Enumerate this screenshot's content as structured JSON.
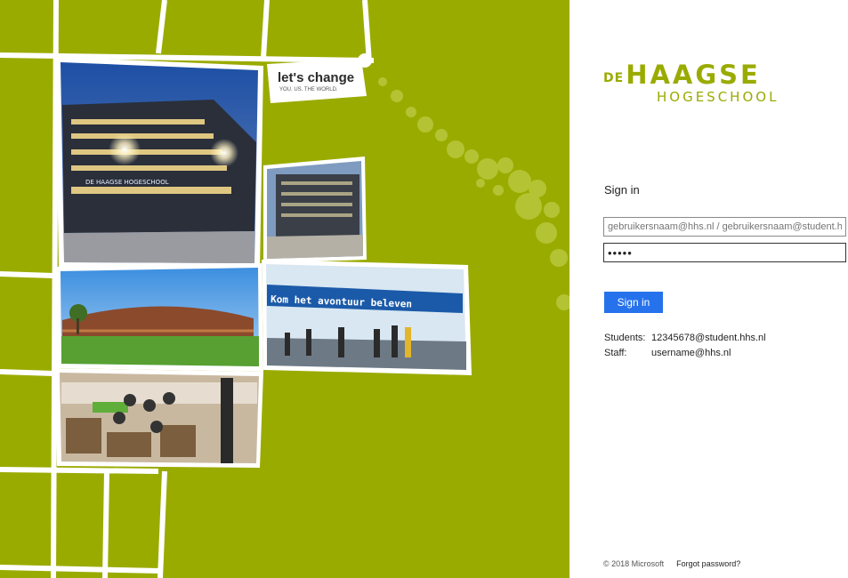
{
  "illustration": {
    "tagline_main": "let's change",
    "tagline_sub": "YOU. US. THE WORLD.",
    "banner_text": "Kom het avontuur beleven",
    "building_sign": "DE HAAGSE HOGESCHOOL"
  },
  "logo": {
    "prefix": "DE",
    "main": "HAAGSE",
    "sub": "HOGESCHOOL"
  },
  "signin": {
    "heading": "Sign in",
    "username_placeholder": "gebruikersnaam@hhs.nl / gebruikersnaam@student.hhs.nl",
    "password_masked": "•••••",
    "submit_label": "Sign in"
  },
  "hints": {
    "students_label": "Students:",
    "students_value": "12345678@student.hhs.nl",
    "staff_label": "Staff:",
    "staff_value": "username@hhs.nl"
  },
  "footer": {
    "copyright": "© 2018 Microsoft",
    "forgot_link": "Forgot password?"
  },
  "colors": {
    "brand_green": "#9aab00",
    "button_blue": "#2672ec"
  }
}
